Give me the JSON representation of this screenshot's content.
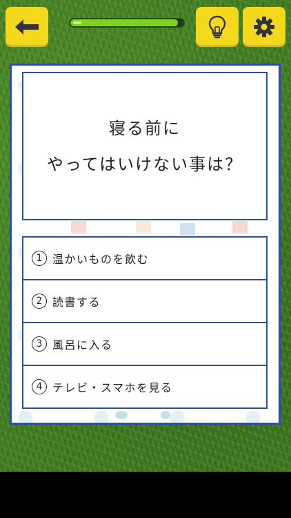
{
  "header": {
    "back_icon": "arrow-left-icon",
    "hint_icon": "lightbulb-icon",
    "settings_icon": "gear-icon",
    "progress_fraction": 0.95,
    "colors": {
      "button": "#f4d81c",
      "progress": "#7ed321"
    }
  },
  "question": {
    "line1": "寝る前に",
    "line2": "やってはいけない事は？"
  },
  "answers": [
    {
      "number": "1",
      "label": "温かいものを飲む"
    },
    {
      "number": "2",
      "label": "読書する"
    },
    {
      "number": "3",
      "label": "風呂に入る"
    },
    {
      "number": "4",
      "label": "テレビ・スマホを見る"
    }
  ],
  "colors": {
    "border": "#2d4f9a",
    "grass": "#3e7a20"
  }
}
